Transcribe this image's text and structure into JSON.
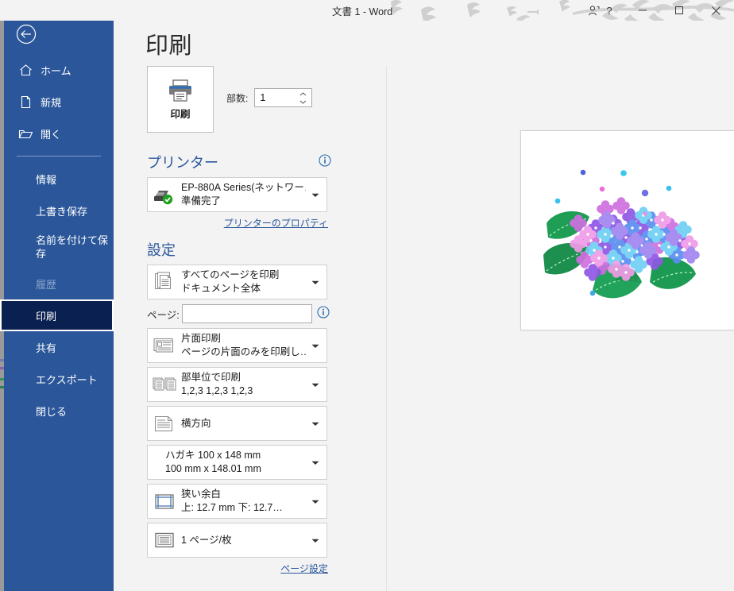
{
  "titlebar": {
    "document_title": "文書 1  -  Word",
    "account_icon": "person-icon",
    "help_icon": "question-mark-icon",
    "minimize_icon": "minimize-icon",
    "maximize_icon": "maximize-icon",
    "close_icon": "close-icon"
  },
  "sidebar": {
    "back_icon": "back-arrow-icon",
    "items": [
      {
        "label": "ホーム",
        "icon": "home-icon",
        "state": "normal"
      },
      {
        "label": "新規",
        "icon": "new-document-icon",
        "state": "normal"
      },
      {
        "label": "開く",
        "icon": "open-folder-icon",
        "state": "normal"
      },
      {
        "label": "情報",
        "icon": "",
        "state": "normal"
      },
      {
        "label": "上書き保存",
        "icon": "",
        "state": "normal"
      },
      {
        "label": "名前を付けて保存",
        "icon": "",
        "state": "normal"
      },
      {
        "label": "履歴",
        "icon": "",
        "state": "disabled"
      },
      {
        "label": "印刷",
        "icon": "",
        "state": "selected"
      },
      {
        "label": "共有",
        "icon": "",
        "state": "normal"
      },
      {
        "label": "エクスポート",
        "icon": "",
        "state": "normal"
      },
      {
        "label": "閉じる",
        "icon": "",
        "state": "normal"
      }
    ]
  },
  "main": {
    "page_title": "印刷",
    "print_button": {
      "label": "印刷",
      "icon": "printer-icon"
    },
    "copies": {
      "label": "部数:",
      "value": "1",
      "spinner_icon": "spinner-arrows-icon"
    },
    "printer_section": {
      "header": "プリンター",
      "info_icon": "info-icon",
      "selected": {
        "name": "EP-880A Series(ネットワー…",
        "status": "準備完了",
        "icon": "printer-device-icon",
        "badge_icon": "green-check-icon"
      },
      "properties_link": "プリンターのプロパティ"
    },
    "settings_section": {
      "header": "設定",
      "page_range": {
        "primary": "すべてのページを印刷",
        "secondary": "ドキュメント全体",
        "icon": "multi-page-icon"
      },
      "pages_field": {
        "label": "ページ:",
        "value": "",
        "placeholder": "",
        "info_icon": "info-icon"
      },
      "sides": {
        "primary": "片面印刷",
        "secondary": "ページの片面のみを印刷し…",
        "icon": "one-sided-icon"
      },
      "collation": {
        "primary": "部単位で印刷",
        "secondary": "1,2,3    1,2,3    1,2,3",
        "icon": "collate-icon"
      },
      "orientation": {
        "primary": "横方向",
        "secondary": "",
        "icon": "landscape-icon"
      },
      "paper_size": {
        "primary": "ハガキ 100 x 148 mm",
        "secondary": "100 mm x 148.01 mm",
        "icon": ""
      },
      "margins": {
        "primary": "狭い余白",
        "secondary": "上: 12.7 mm 下: 12.7…",
        "icon": "margins-icon"
      },
      "pages_per_sheet": {
        "primary": "1 ページ/枚",
        "secondary": "",
        "icon": "pages-per-sheet-icon"
      },
      "page_setup_link": "ページ設定"
    },
    "preview": {
      "content_name": "hydrangea-illustration",
      "orientation": "landscape"
    }
  },
  "colors": {
    "backstage_blue": "#2b579a",
    "selected_nav": "#0a2050",
    "accent_link": "#2b579a",
    "panel_bg": "#f3f3f3",
    "status_green": "#21a121"
  }
}
